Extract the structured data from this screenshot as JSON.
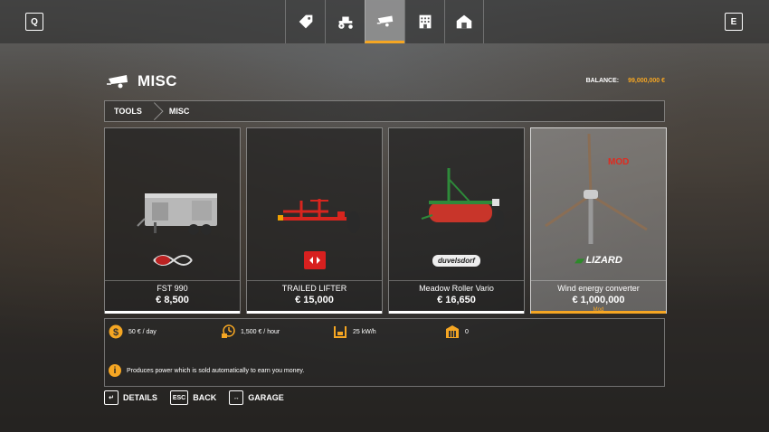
{
  "topbar": {
    "left_key": "Q",
    "right_key": "E",
    "tabs": [
      {
        "icon": "price-tag-icon",
        "active": false
      },
      {
        "icon": "tractor-icon",
        "active": false
      },
      {
        "icon": "trailer-icon",
        "active": true
      },
      {
        "icon": "building-icon",
        "active": false
      },
      {
        "icon": "barn-icon",
        "active": false
      }
    ]
  },
  "header": {
    "title": "MISC",
    "balance_label": "BALANCE:",
    "balance_value": "99,000,000 €"
  },
  "breadcrumb": [
    "TOOLS",
    "MISC"
  ],
  "items": [
    {
      "name": "FST 990",
      "price": "€ 8,500",
      "brand_icon": "swirl-logo-icon",
      "selected": false
    },
    {
      "name": "TRAILED LIFTER",
      "price": "€ 15,000",
      "brand_icon": "red-brand-badge-icon",
      "selected": false
    },
    {
      "name": "Meadow Roller Vario",
      "price": "€ 16,650",
      "brand": "duvelsdorf",
      "selected": false
    },
    {
      "name": "Wind energy converter",
      "price": "€ 1,000,000",
      "brand": "LIZARD",
      "mod_badge": "MOD",
      "mod_sub": "Mod",
      "selected": true
    }
  ],
  "details": {
    "stats": [
      {
        "icon": "money-icon",
        "text": "50 € / day"
      },
      {
        "icon": "hourly-cost-icon",
        "text": "1,500 € / hour"
      },
      {
        "icon": "power-icon",
        "text": "25 kW/h"
      },
      {
        "icon": "storage-icon",
        "text": "0"
      }
    ],
    "description": "Produces power which is sold automatically to earn you money."
  },
  "actions": [
    {
      "key": "↵",
      "label": "DETAILS"
    },
    {
      "key": "ESC",
      "label": "BACK"
    },
    {
      "key": "↔",
      "label": "GARAGE"
    }
  ],
  "colors": {
    "accent": "#f5a623",
    "mod_red": "#e02a1f"
  }
}
